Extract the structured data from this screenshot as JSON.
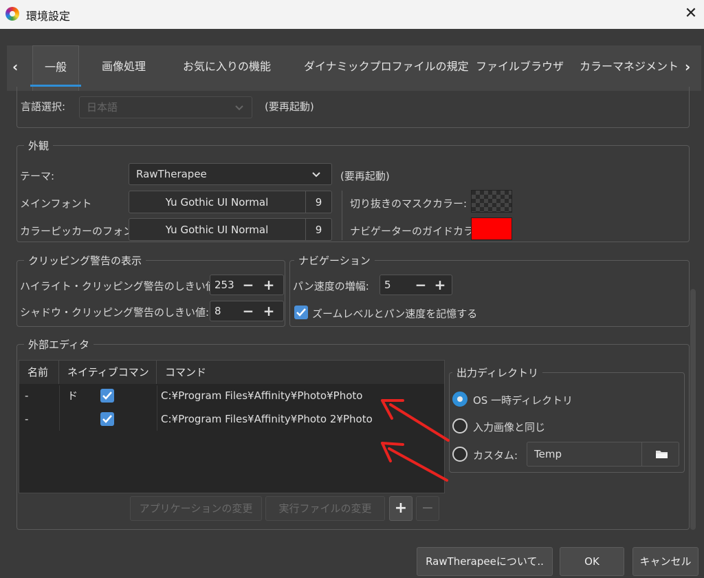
{
  "window": {
    "title": "環境設定",
    "close": "✕"
  },
  "tabs": [
    {
      "label": "一般",
      "active": true
    },
    {
      "label": "画像処理"
    },
    {
      "label": "お気に入りの機能"
    },
    {
      "label": "ダイナミックプロファイルの規定"
    },
    {
      "label": "ファイルブラウザ"
    },
    {
      "label": "カラーマネジメント"
    }
  ],
  "language": {
    "label": "言語選択:",
    "value": "日本語",
    "note": "(要再起動)"
  },
  "appearance": {
    "legend": "外観",
    "theme_label": "テーマ:",
    "theme_value": "RawTherapee",
    "theme_note": "(要再起動)",
    "main_font_label": "メインフォント",
    "main_font_name": "Yu Gothic UI Normal",
    "main_font_size": "9",
    "picker_font_label": "カラーピッカーのフォント:",
    "picker_font_name": "Yu Gothic UI Normal",
    "picker_font_size": "9",
    "crop_mask_label": "切り抜きのマスクカラー:",
    "nav_guide_label": "ナビゲーターのガイドカラー:",
    "nav_guide_color": "#ff0000"
  },
  "clipping": {
    "legend": "クリッピング警告の表示",
    "highlight_label": "ハイライト・クリッピング警告のしきい値:",
    "highlight_value": "253",
    "shadow_label": "シャドウ・クリッピング警告のしきい値:",
    "shadow_value": "8",
    "minus": "−",
    "plus": "+"
  },
  "navigation": {
    "legend": "ナビゲーション",
    "pan_label": "パン速度の増幅:",
    "pan_value": "5",
    "remember_label": "ズームレベルとパン速度を記憶する",
    "remember_checked": true
  },
  "external_editor": {
    "legend": "外部エディタ",
    "columns": [
      "名前",
      "ネイティブコマンド",
      "コマンド"
    ],
    "rows": [
      {
        "name": "-",
        "native": true,
        "command": "C:¥Program Files¥Affinity¥Photo¥Photo"
      },
      {
        "name": "-",
        "native": true,
        "command": "C:¥Program Files¥Affinity¥Photo 2¥Photo"
      }
    ],
    "change_app": "アプリケーションの変更",
    "change_exe": "実行ファイルの変更",
    "add": "+",
    "remove": "−"
  },
  "output_dir": {
    "legend": "出力ディレクトリ",
    "options": [
      {
        "label": "OS 一時ディレクトリ",
        "checked": true
      },
      {
        "label": "入力画像と同じ"
      },
      {
        "label": "カスタム:"
      }
    ],
    "custom_value": "Temp"
  },
  "buttons": {
    "about": "RawTherapeeについて..",
    "ok": "OK",
    "cancel": "キャンセル"
  },
  "annotation_color": "#e8231f"
}
